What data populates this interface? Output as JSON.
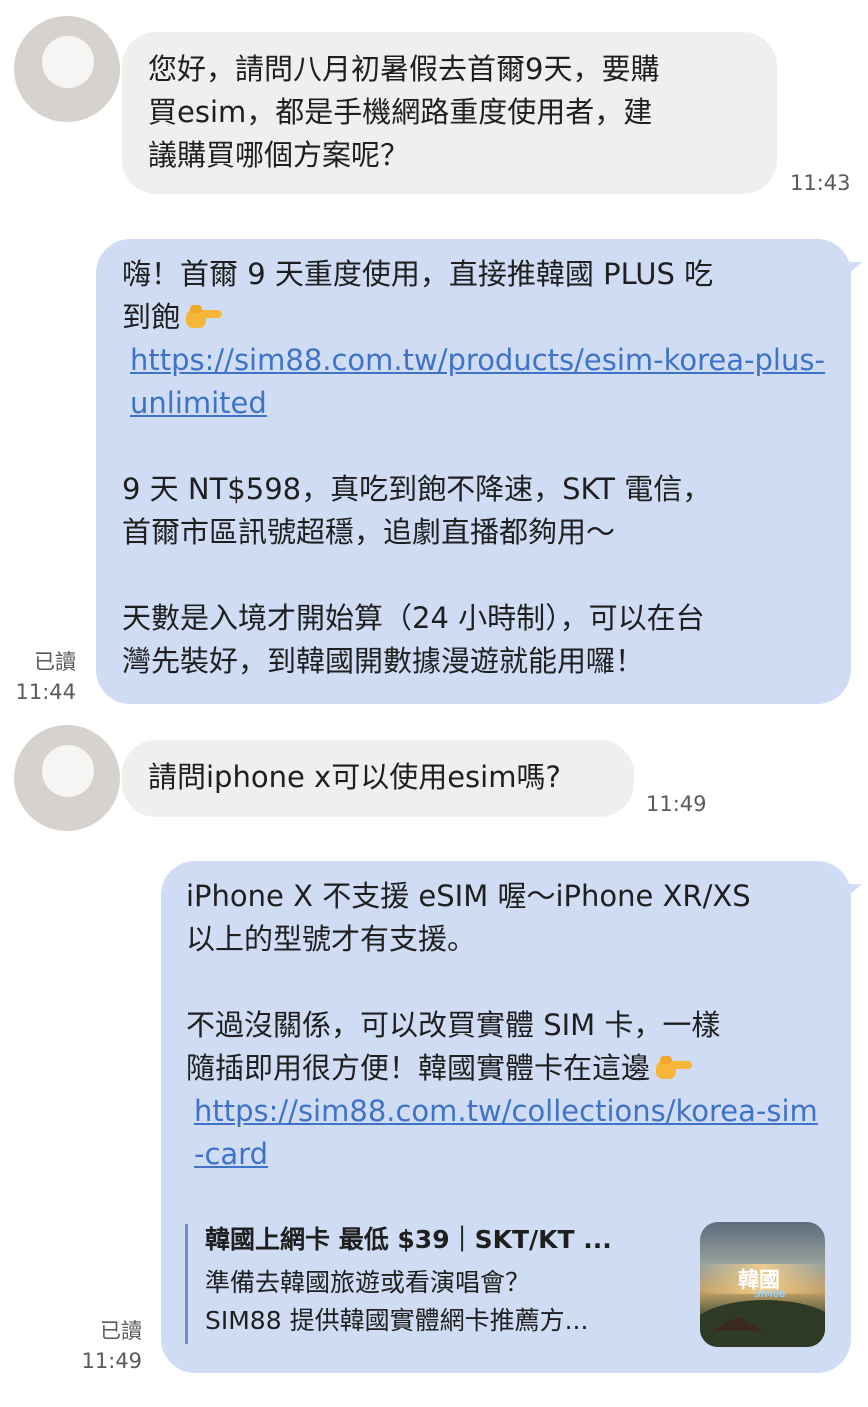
{
  "messages": [
    {
      "side": "incoming",
      "lines": [
        "您好，請問八月初暑假去首爾9天，要購",
        "買esim，都是手機網路重度使用者，建",
        "議購買哪個方案呢？"
      ],
      "time": "11:43"
    },
    {
      "side": "outgoing",
      "lines": [
        "嗨！首爾 9 天重度使用，直接推韓國 PLUS 吃",
        "到飽"
      ],
      "emoji": "backhand-index-pointing-right",
      "link": "https://sim88.com.tw/products/esim-korea-plus-unlimited",
      "para2": [
        "9 天 NT$598，真吃到飽不降速，SKT 電信，",
        "首爾市區訊號超穩，追劇直播都夠用～"
      ],
      "para3": [
        "天數是入境才開始算（24 小時制），可以在台",
        "灣先裝好，到韓國開數據漫遊就能用囉！"
      ],
      "read": "已讀",
      "time": "11:44"
    },
    {
      "side": "incoming",
      "lines": [
        "請問iphone x可以使用esim嗎?"
      ],
      "time": "11:49"
    },
    {
      "side": "outgoing",
      "para1": [
        "iPhone X 不支援 eSIM 喔～iPhone XR/XS",
        "以上的型號才有支援。"
      ],
      "para2": [
        "不過沒關係，可以改買實體 SIM 卡，一樣",
        "隨插即用很方便！韓國實體卡在這邊"
      ],
      "emoji": "backhand-index-pointing-right",
      "link": "https://sim88.com.tw/collections/korea-sim-card",
      "preview": {
        "title": "韓國上網卡 最低 $39｜SKT/KT ...",
        "desc1": "準備去韓國旅遊或看演唱會？",
        "desc2": "SIM88 提供韓國實體網卡推薦方...",
        "thumb_text": "韓國",
        "thumb_sub": "SIM88"
      },
      "read": "已讀",
      "time": "11:49"
    }
  ],
  "colors": {
    "incoming_bubble": "#efefef",
    "outgoing_bubble": "#cfdcf4",
    "link": "#3e73c8",
    "avatar": "#d6d3cf"
  }
}
